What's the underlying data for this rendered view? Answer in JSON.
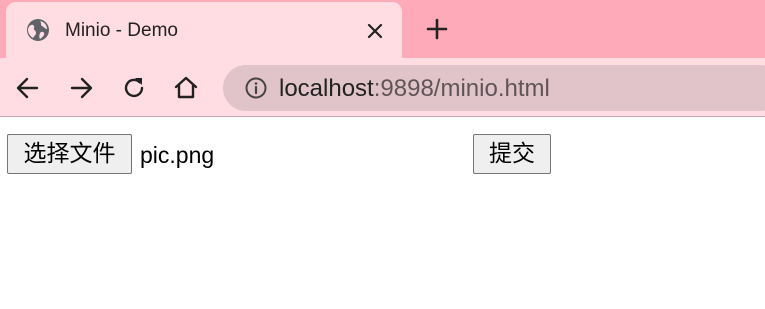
{
  "browser": {
    "tab": {
      "title": "Minio - Demo",
      "favicon": "globe-icon"
    },
    "address_bar": {
      "host": "localhost",
      "rest": ":9898/minio.html"
    },
    "colors": {
      "frame": "#ffaab9",
      "toolbar": "#ffdde3",
      "address_bar": "#e0c4c9"
    }
  },
  "page": {
    "file_input": {
      "button_label": "选择文件",
      "file_name": "pic.png"
    },
    "submit_label": "提交"
  }
}
